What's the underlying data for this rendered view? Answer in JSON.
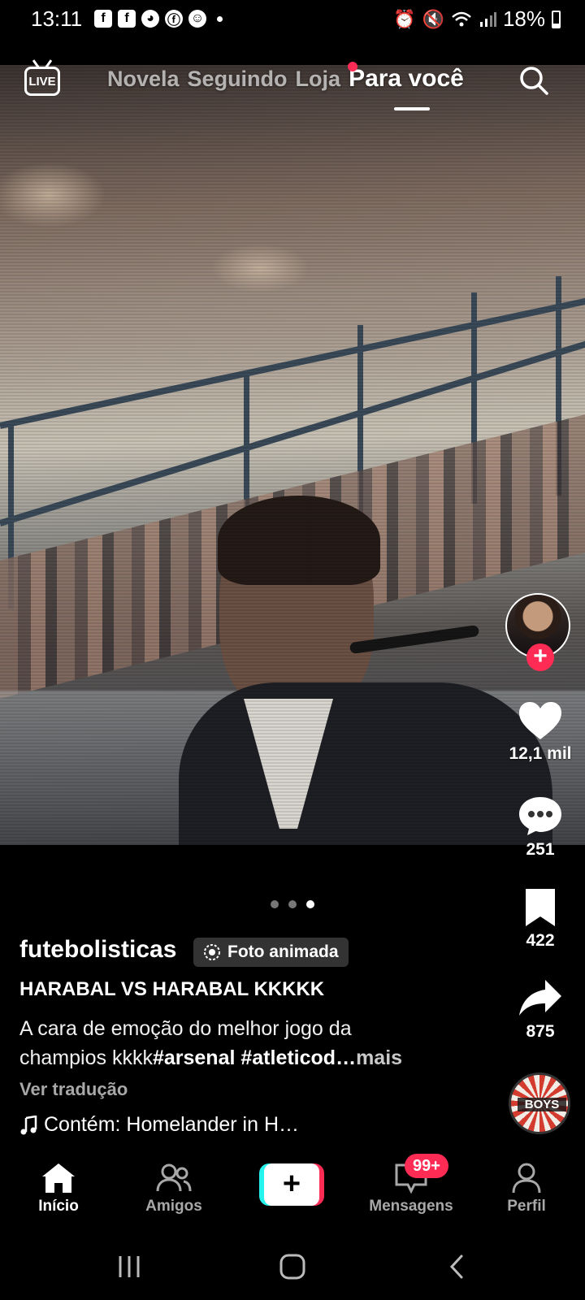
{
  "status_bar": {
    "time": "13:11",
    "notifications": [
      "f",
      "f",
      "◕",
      "ⓕ",
      "☺"
    ],
    "battery": "18%"
  },
  "top_nav": {
    "live_label": "LIVE",
    "tabs": [
      "Novela",
      "Seguindo",
      "Loja",
      "Para você"
    ],
    "active_tab": "Para você"
  },
  "post": {
    "author": "futebolisticas",
    "badge": "Foto animada",
    "title": "HARABAL VS HARABAL KKKKK",
    "description_line1": "A cara de emoção do melhor jogo da",
    "description_line2_text": "champios kkkk",
    "description_hashtags": "#arsenal #atleticod…",
    "more_label": "mais",
    "translate_label": "Ver tradução",
    "music": "Contém: Homelander in H…",
    "carousel": {
      "count": 3,
      "active_index": 2
    }
  },
  "actions": {
    "likes": "12,1 mil",
    "comments": "251",
    "saves": "422",
    "shares": "875",
    "disc_label": "BOYS"
  },
  "bottom_nav": {
    "items": [
      "Início",
      "Amigos",
      "",
      "Mensagens",
      "Perfil"
    ],
    "active": "Início",
    "messages_badge": "99+"
  },
  "colors": {
    "accent": "#fe2c55",
    "cyan": "#25f4ee",
    "muted": "#a8a8a8"
  }
}
